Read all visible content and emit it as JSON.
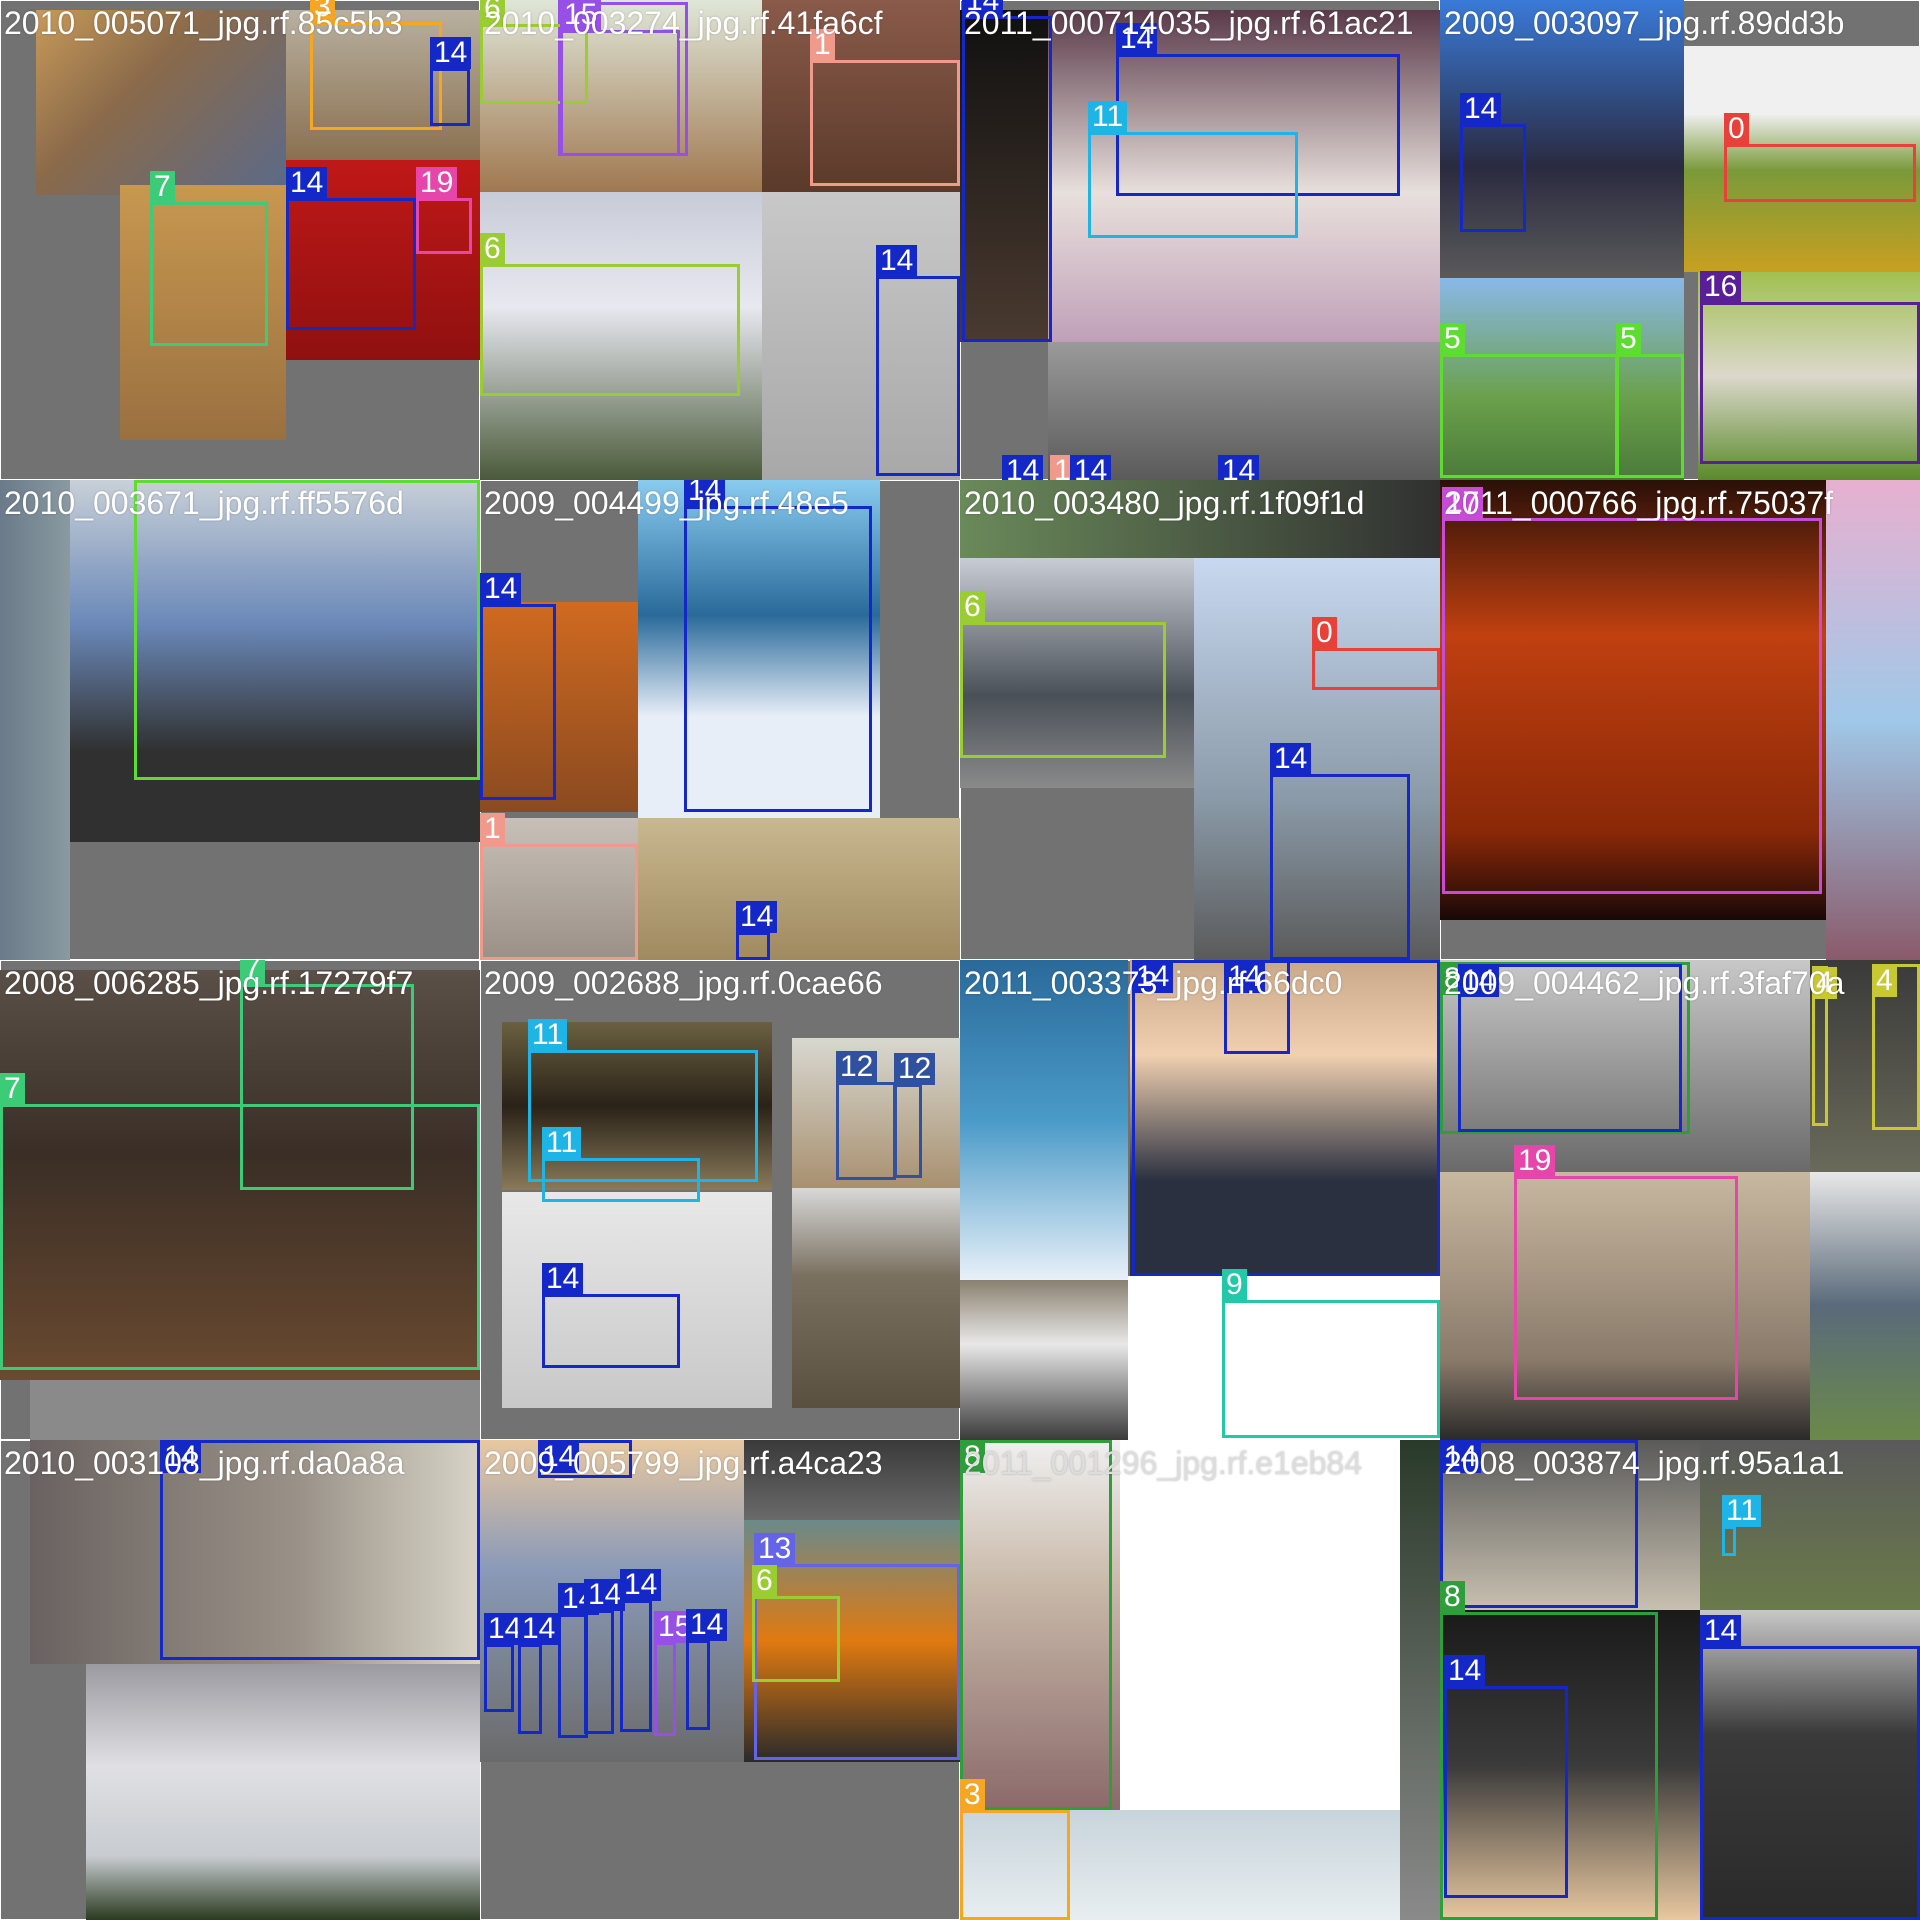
{
  "mosaic": {
    "tiles": [
      {
        "title": "2010_005071_jpg.rf.85c5b3",
        "labels": [
          "3",
          "14",
          "14",
          "7",
          "14",
          "19"
        ]
      },
      {
        "title": "2010_003274_jpg.rf.41fa6cf",
        "labels": [
          "15",
          "6",
          "15",
          "1",
          "6",
          "14"
        ]
      },
      {
        "title": "2011_000714035_jpg.rf.61ac21",
        "labels": [
          "14",
          "14",
          "11",
          "14",
          "1",
          "14",
          "14"
        ]
      },
      {
        "title": "2009_003097_jpg.rf.89dd3b",
        "labels": [
          "14",
          "0",
          "5",
          "5",
          "16"
        ]
      },
      {
        "title": "2010_003671_jpg.rf.ff5576d",
        "labels": [
          "5"
        ]
      },
      {
        "title": "2009_004499_jpg.rf.48e5",
        "labels": [
          "14",
          "14",
          "1",
          "14"
        ]
      },
      {
        "title": "2010_003480_jpg.rf.1f09f1d",
        "labels": [
          "6",
          "0",
          "14"
        ]
      },
      {
        "title": "2011_000766_jpg.rf.75037f",
        "labels": [
          "17"
        ]
      },
      {
        "title": "2008_006285_jpg.rf.17279f7",
        "labels": [
          "7",
          "7"
        ]
      },
      {
        "title": "2009_002688_jpg.rf.0cae66",
        "labels": [
          "11",
          "11",
          "12",
          "12",
          "14"
        ]
      },
      {
        "title": "2011_003373_jpg.rf.66dc0",
        "labels": [
          "14",
          "14",
          "9"
        ]
      },
      {
        "title": "2009_004462_jpg.rf.3faf70a",
        "labels": [
          "8",
          "14",
          "4",
          "4",
          "19"
        ]
      },
      {
        "title": "2010_003108_jpg.rf.da0a8a",
        "labels": [
          "14"
        ]
      },
      {
        "title": "2009_005799_jpg.rf.a4ca23",
        "labels": [
          "14",
          "14",
          "14",
          "14",
          "14",
          "14",
          "15",
          "14",
          "13",
          "6"
        ]
      },
      {
        "title": "2011_001296_jpg.rf.e1eb84",
        "labels": [
          "8",
          "3"
        ]
      },
      {
        "title": "2008_003874_jpg.rf.95a1a1",
        "labels": [
          "14",
          "11",
          "8",
          "14",
          "14"
        ]
      }
    ]
  },
  "class_colors": {
    "0": "#e8413a",
    "1": "#f09a8c",
    "3": "#f5a623",
    "4": "#c8c832",
    "5": "#5fdc32",
    "6": "#9acd32",
    "7": "#3ccc78",
    "8": "#2e9e3a",
    "9": "#23c8a8",
    "11": "#1eb4e6",
    "12": "#3050a0",
    "13": "#6464e6",
    "14": "#1428c8",
    "15": "#9650e6",
    "16": "#5a1e96",
    "17": "#c84bd8",
    "19": "#e646aa"
  }
}
